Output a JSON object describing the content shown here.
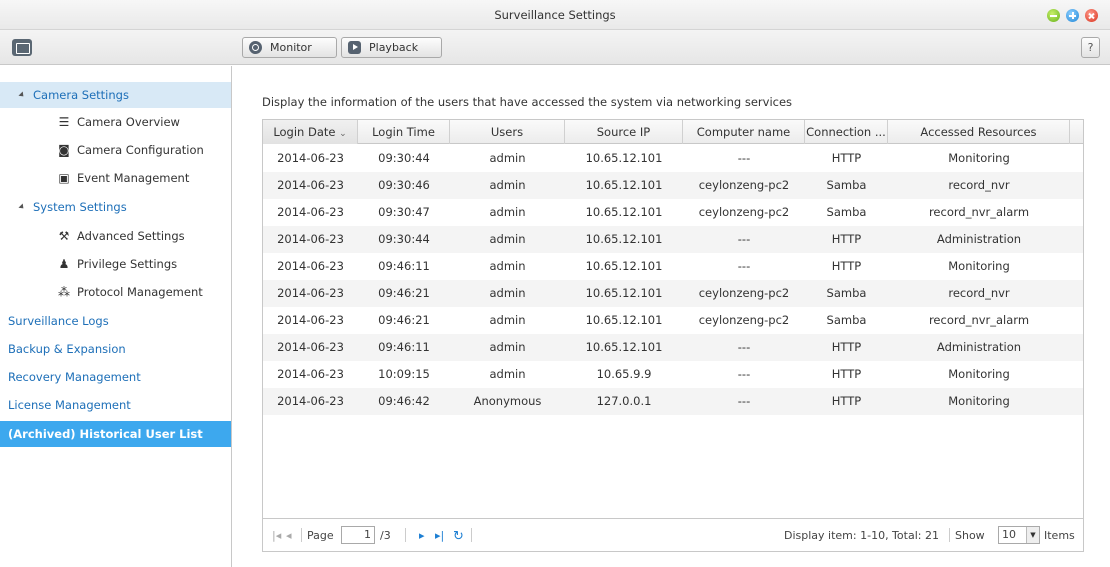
{
  "window": {
    "title": "Surveillance Settings"
  },
  "toolbar": {
    "monitor_label": "Monitor",
    "playback_label": "Playback",
    "help_label": "?"
  },
  "sidebar": {
    "camera_settings": "Camera Settings",
    "camera_overview": "Camera Overview",
    "camera_configuration": "Camera Configuration",
    "event_management": "Event Management",
    "system_settings": "System Settings",
    "advanced_settings": "Advanced Settings",
    "privilege_settings": "Privilege Settings",
    "protocol_management": "Protocol Management",
    "surveillance_logs": "Surveillance Logs",
    "backup_expansion": "Backup & Expansion",
    "recovery_management": "Recovery Management",
    "license_management": "License Management",
    "historical_user_list": "(Archived) Historical User List"
  },
  "main": {
    "description": "Display the information of the users that have accessed the system via networking services",
    "columns": [
      "Login Date",
      "Login Time",
      "Users",
      "Source IP",
      "Computer name",
      "Connection ...",
      "Accessed Resources"
    ],
    "sort_indicator": "⌄",
    "rows": [
      [
        "2014-06-23",
        "09:30:44",
        "admin",
        "10.65.12.101",
        "---",
        "HTTP",
        "Monitoring"
      ],
      [
        "2014-06-23",
        "09:30:46",
        "admin",
        "10.65.12.101",
        "ceylonzeng-pc2",
        "Samba",
        "record_nvr"
      ],
      [
        "2014-06-23",
        "09:30:47",
        "admin",
        "10.65.12.101",
        "ceylonzeng-pc2",
        "Samba",
        "record_nvr_alarm"
      ],
      [
        "2014-06-23",
        "09:30:44",
        "admin",
        "10.65.12.101",
        "---",
        "HTTP",
        "Administration"
      ],
      [
        "2014-06-23",
        "09:46:11",
        "admin",
        "10.65.12.101",
        "---",
        "HTTP",
        "Monitoring"
      ],
      [
        "2014-06-23",
        "09:46:21",
        "admin",
        "10.65.12.101",
        "ceylonzeng-pc2",
        "Samba",
        "record_nvr"
      ],
      [
        "2014-06-23",
        "09:46:21",
        "admin",
        "10.65.12.101",
        "ceylonzeng-pc2",
        "Samba",
        "record_nvr_alarm"
      ],
      [
        "2014-06-23",
        "09:46:11",
        "admin",
        "10.65.12.101",
        "---",
        "HTTP",
        "Administration"
      ],
      [
        "2014-06-23",
        "10:09:15",
        "admin",
        "10.65.9.9",
        "---",
        "HTTP",
        "Monitoring"
      ],
      [
        "2014-06-23",
        "09:46:42",
        "Anonymous",
        "127.0.0.1",
        "---",
        "HTTP",
        "Monitoring"
      ]
    ]
  },
  "pager": {
    "page_label": "Page",
    "page_value": "1",
    "page_total": "/3",
    "display_text": "Display item: 1-10, Total: 21",
    "show_label": "Show",
    "show_value": "10",
    "items_label": "Items"
  }
}
